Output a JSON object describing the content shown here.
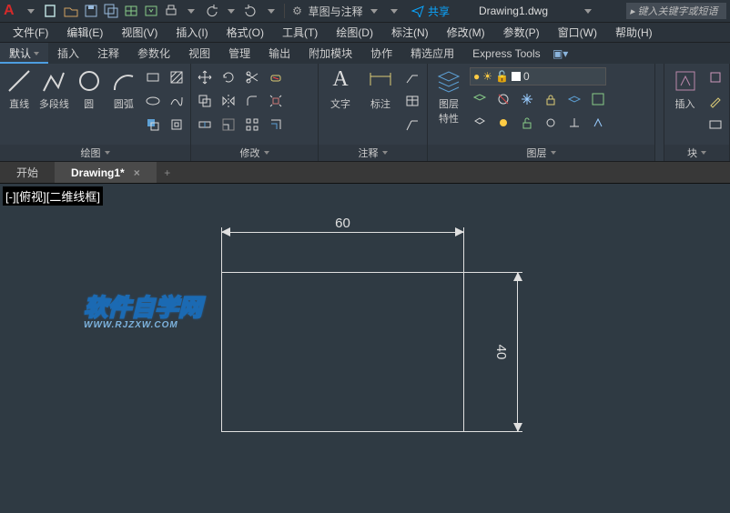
{
  "qat": {
    "logo": "A",
    "workspace": "草图与注释",
    "share": "共享",
    "title": "Drawing1.dwg",
    "search_placeholder": "键入关键字或短语"
  },
  "menubar": [
    "文件(F)",
    "编辑(E)",
    "视图(V)",
    "插入(I)",
    "格式(O)",
    "工具(T)",
    "绘图(D)",
    "标注(N)",
    "修改(M)",
    "参数(P)",
    "窗口(W)",
    "帮助(H)"
  ],
  "tabs": [
    "默认",
    "插入",
    "注释",
    "参数化",
    "视图",
    "管理",
    "输出",
    "附加模块",
    "协作",
    "精选应用",
    "Express Tools"
  ],
  "ribbon": {
    "draw": {
      "title": "绘图",
      "l1": "直线",
      "l2": "多段线",
      "l3": "圆",
      "l4": "圆弧"
    },
    "modify": {
      "title": "修改"
    },
    "annot": {
      "title": "注释",
      "t1": "文字",
      "t2": "标注"
    },
    "layers": {
      "title": "图层",
      "bigLabel": "图层\n特性",
      "combo_value": "0"
    },
    "block": {
      "title": "块",
      "b1": "插入"
    }
  },
  "doc_tabs": {
    "t1": "开始",
    "t2": "Drawing1*"
  },
  "canvas": {
    "view_label": "[-][俯视][二维线框]",
    "dim_w": "60",
    "dim_h": "40",
    "watermark": "软件自学网",
    "watermark_sub": "WWW.RJZXW.COM"
  },
  "chart_data": {
    "type": "diagram",
    "shape": "rectangle",
    "width": 60,
    "height": 40,
    "units": "mm"
  }
}
